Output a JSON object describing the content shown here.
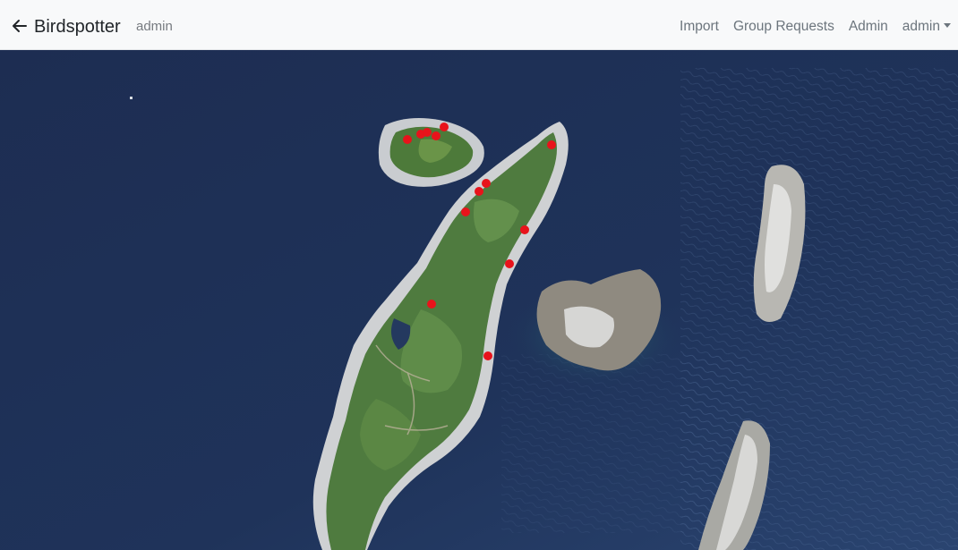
{
  "navbar": {
    "back_icon": "arrow-left-icon",
    "brand": "Birdspotter",
    "user_chip": "admin",
    "links": {
      "import": "Import",
      "group_requests": "Group Requests",
      "admin": "Admin",
      "user_menu": "admin"
    }
  },
  "map": {
    "marker_color": "#e8131b",
    "marker_count": 13,
    "layer": "satellite"
  }
}
